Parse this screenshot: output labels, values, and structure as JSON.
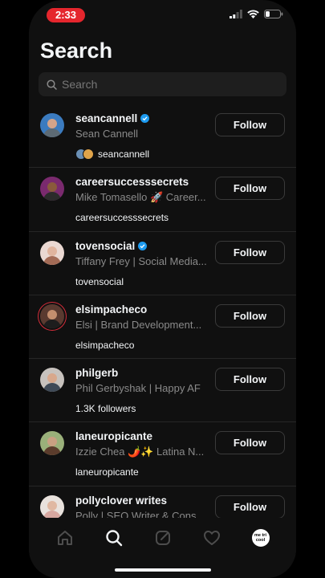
{
  "status": {
    "time": "2:33"
  },
  "header": {
    "title": "Search"
  },
  "search": {
    "placeholder": "Search"
  },
  "results": [
    {
      "username": "seancannell",
      "verified": true,
      "fullname": "Sean Cannell",
      "meta": "seancannell",
      "meta_type": "mutual",
      "follow_label": "Follow",
      "avatar_bg": "#3b7bbf"
    },
    {
      "username": "careersuccesssecrets",
      "verified": false,
      "fullname": "Mike Tomasello 🚀 Career...",
      "meta": "careersuccesssecrets",
      "meta_type": "text",
      "follow_label": "Follow",
      "avatar_bg": "#7a2a6e"
    },
    {
      "username": "tovensocial",
      "verified": true,
      "fullname": "Tiffany Frey | Social Media...",
      "meta": "tovensocial",
      "meta_type": "text",
      "follow_label": "Follow",
      "avatar_bg": "#e8d9d4"
    },
    {
      "username": "elsimpacheco",
      "verified": false,
      "fullname": "Elsi | Brand Development...",
      "meta": "elsimpacheco",
      "meta_type": "text",
      "follow_label": "Follow",
      "avatar_bg": "#5a3a30"
    },
    {
      "username": "philgerb",
      "verified": false,
      "fullname": "Phil Gerbyshak | Happy AF",
      "meta": "1.3K followers",
      "meta_type": "text",
      "follow_label": "Follow",
      "avatar_bg": "#c7c2bd"
    },
    {
      "username": "laneuropicante",
      "verified": false,
      "fullname": "Izzie Chea 🌶️✨ Latina N...",
      "meta": "laneuropicante",
      "meta_type": "text",
      "follow_label": "Follow",
      "avatar_bg": "#9ab07a"
    },
    {
      "username": "pollyclover writes",
      "verified": false,
      "fullname": "Polly | SEO Writer & Consu...",
      "meta": "",
      "meta_type": "text",
      "follow_label": "Follow",
      "avatar_bg": "#e9e2dd"
    }
  ],
  "tabbar": {
    "profile_label": "me tri cool"
  },
  "colors": {
    "accent_verified": "#1d9bf0",
    "time_pill": "#e5262d"
  }
}
